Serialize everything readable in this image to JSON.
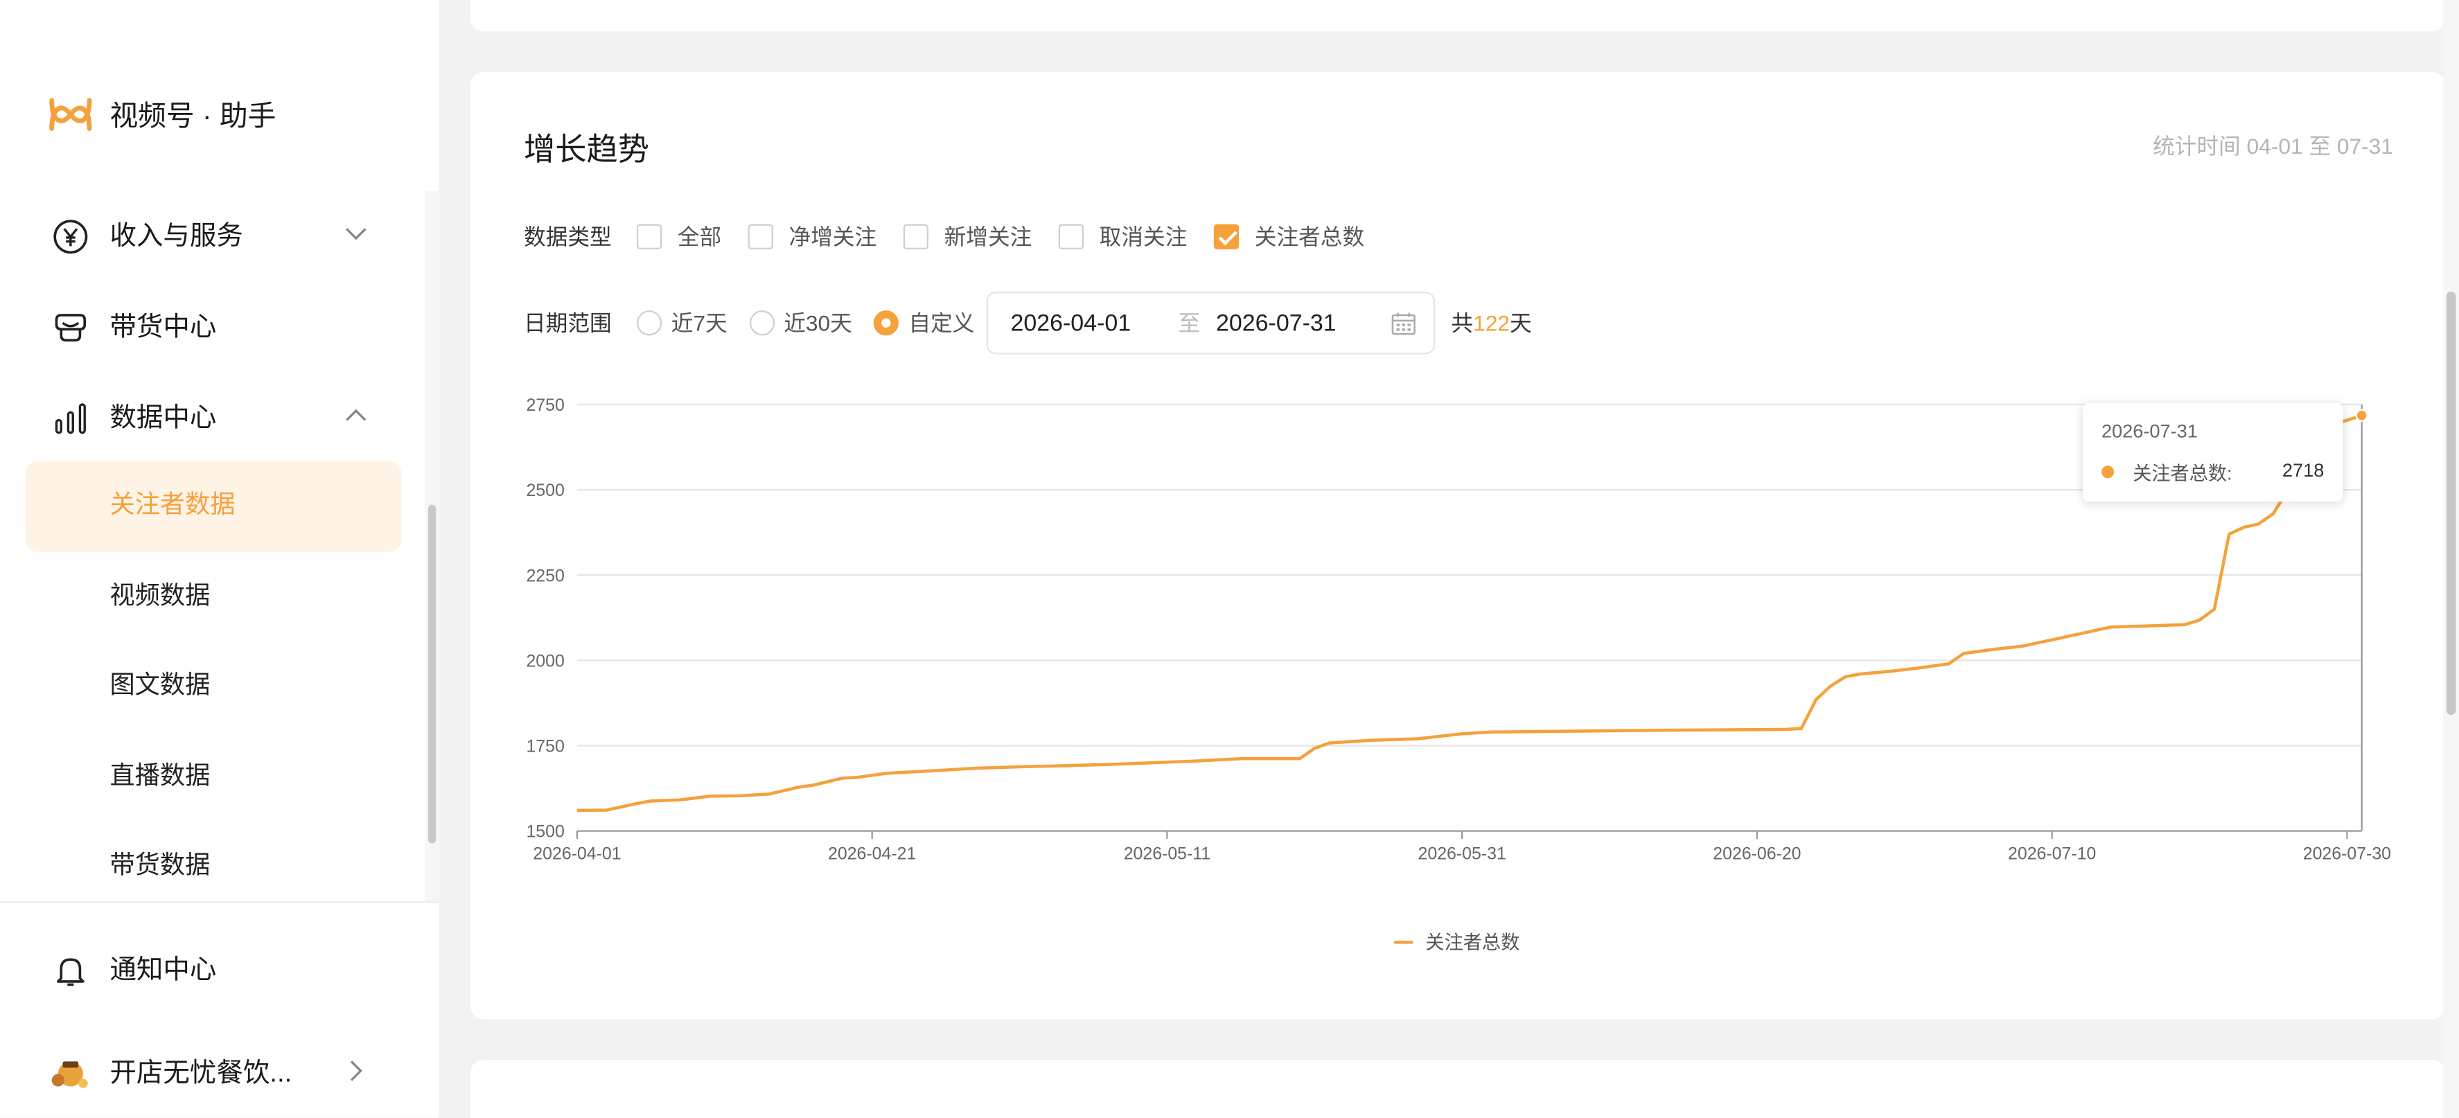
{
  "app": {
    "name": "视频号 · 助手"
  },
  "sidebar": {
    "items": [
      {
        "label": "收入与服务",
        "icon": "yen-circle-icon",
        "expanded": false
      },
      {
        "label": "带货中心",
        "icon": "shop-bag-icon"
      },
      {
        "label": "数据中心",
        "icon": "bar-chart-icon",
        "expanded": true,
        "children": [
          {
            "label": "关注者数据",
            "active": true
          },
          {
            "label": "视频数据"
          },
          {
            "label": "图文数据"
          },
          {
            "label": "直播数据"
          },
          {
            "label": "带货数据"
          }
        ]
      }
    ],
    "notification": {
      "label": "通知中心",
      "icon": "bell-icon"
    },
    "account": {
      "label": "开店无忧餐饮...",
      "icon": "avatar"
    }
  },
  "card": {
    "title": "增长趋势",
    "stat_time": "统计时间 04-01 至 07-31",
    "data_type": {
      "label": "数据类型",
      "options": [
        {
          "label": "全部",
          "checked": false
        },
        {
          "label": "净增关注",
          "checked": false
        },
        {
          "label": "新增关注",
          "checked": false
        },
        {
          "label": "取消关注",
          "checked": false
        },
        {
          "label": "关注者总数",
          "checked": true
        }
      ]
    },
    "date_range": {
      "label": "日期范围",
      "options": [
        {
          "label": "近7天",
          "checked": false
        },
        {
          "label": "近30天",
          "checked": false
        },
        {
          "label": "自定义",
          "checked": true
        }
      ],
      "start": "2026-04-01",
      "separator": "至",
      "end": "2026-07-31",
      "total_prefix": "共",
      "total_days": "122",
      "total_suffix": "天"
    }
  },
  "chart_data": {
    "type": "line",
    "xlabel": "",
    "ylabel": "",
    "ylim": [
      1500,
      2750
    ],
    "yticks": [
      "1500",
      "1750",
      "2000",
      "2250",
      "2500",
      "2750"
    ],
    "xticks": [
      "2026-04-01",
      "2026-04-21",
      "2026-05-11",
      "2026-05-31",
      "2026-06-20",
      "2026-07-10",
      "2026-07-30"
    ],
    "grid": true,
    "legend_position": "bottom",
    "series": [
      {
        "name": "关注者总数",
        "color": "#f5a13c",
        "points": [
          [
            "2026-04-01",
            1560
          ],
          [
            "2026-04-03",
            1561
          ],
          [
            "2026-04-05",
            1580
          ],
          [
            "2026-04-06",
            1588
          ],
          [
            "2026-04-08",
            1591
          ],
          [
            "2026-04-10",
            1602
          ],
          [
            "2026-04-12",
            1603
          ],
          [
            "2026-04-14",
            1608
          ],
          [
            "2026-04-16",
            1628
          ],
          [
            "2026-04-17",
            1634
          ],
          [
            "2026-04-19",
            1655
          ],
          [
            "2026-04-20",
            1657
          ],
          [
            "2026-04-22",
            1669
          ],
          [
            "2026-04-25",
            1676
          ],
          [
            "2026-04-28",
            1684
          ],
          [
            "2026-05-01",
            1688
          ],
          [
            "2026-05-04",
            1691
          ],
          [
            "2026-05-07",
            1695
          ],
          [
            "2026-05-10",
            1700
          ],
          [
            "2026-05-13",
            1705
          ],
          [
            "2026-05-16",
            1712
          ],
          [
            "2026-05-20",
            1712
          ],
          [
            "2026-05-21",
            1742
          ],
          [
            "2026-05-22",
            1758
          ],
          [
            "2026-05-25",
            1766
          ],
          [
            "2026-05-28",
            1770
          ],
          [
            "2026-05-30",
            1780
          ],
          [
            "2026-05-31",
            1785
          ],
          [
            "2026-06-02",
            1790
          ],
          [
            "2026-06-06",
            1792
          ],
          [
            "2026-06-11",
            1794
          ],
          [
            "2026-06-16",
            1796
          ],
          [
            "2026-06-22",
            1798
          ],
          [
            "2026-06-23",
            1800
          ],
          [
            "2026-06-24",
            1885
          ],
          [
            "2026-06-25",
            1925
          ],
          [
            "2026-06-26",
            1952
          ],
          [
            "2026-06-27",
            1960
          ],
          [
            "2026-06-29",
            1968
          ],
          [
            "2026-07-01",
            1978
          ],
          [
            "2026-07-03",
            1990
          ],
          [
            "2026-07-04",
            2020
          ],
          [
            "2026-07-06",
            2032
          ],
          [
            "2026-07-08",
            2042
          ],
          [
            "2026-07-10",
            2060
          ],
          [
            "2026-07-12",
            2079
          ],
          [
            "2026-07-14",
            2098
          ],
          [
            "2026-07-16",
            2100
          ],
          [
            "2026-07-19",
            2105
          ],
          [
            "2026-07-20",
            2118
          ],
          [
            "2026-07-21",
            2150
          ],
          [
            "2026-07-22",
            2370
          ],
          [
            "2026-07-23",
            2390
          ],
          [
            "2026-07-24",
            2400
          ],
          [
            "2026-07-25",
            2430
          ],
          [
            "2026-07-26",
            2500
          ],
          [
            "2026-07-28",
            2650
          ],
          [
            "2026-07-29",
            2690
          ],
          [
            "2026-07-31",
            2718
          ]
        ]
      }
    ],
    "tooltip": {
      "date": "2026-07-31",
      "name": "关注者总数:",
      "value": "2718"
    }
  }
}
